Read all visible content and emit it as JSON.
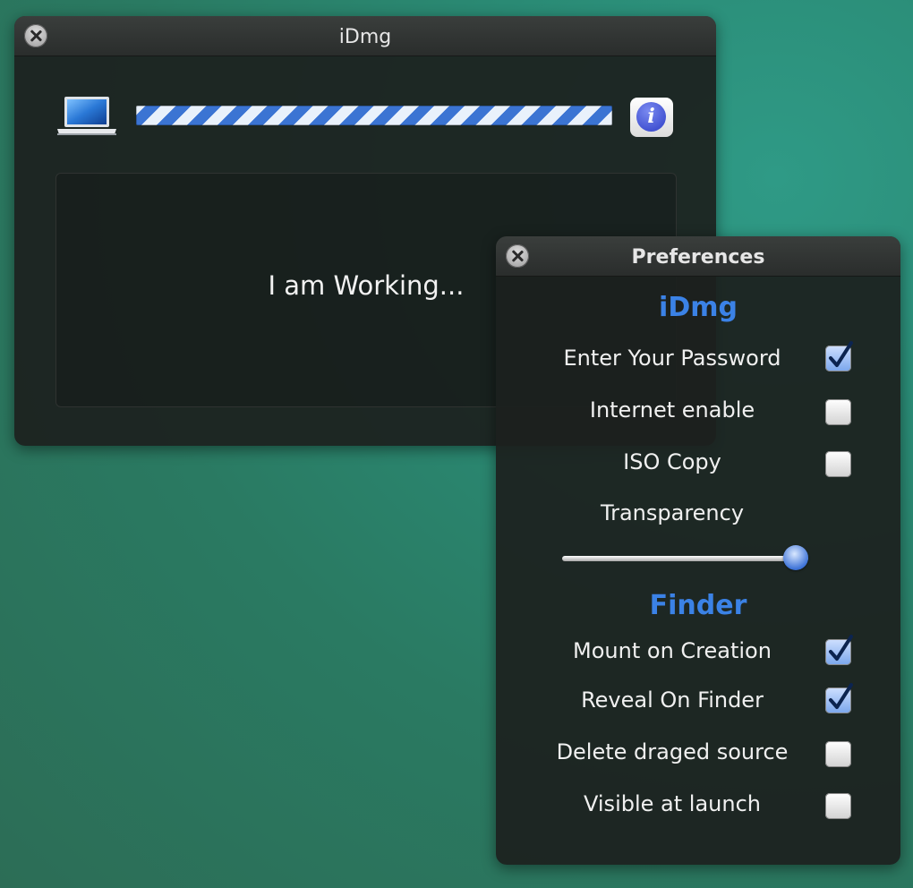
{
  "main_window": {
    "title": "iDmg",
    "status_text": "I am Working...",
    "progress_style": "indeterminate",
    "info_button_glyph": "i",
    "icons": {
      "close": "close-icon",
      "laptop": "laptop-icon",
      "info": "info-icon"
    }
  },
  "preferences": {
    "title": "Preferences",
    "sections": [
      {
        "heading": "iDmg",
        "items": [
          {
            "label": "Enter Your Password",
            "checked": true
          },
          {
            "label": "Internet enable",
            "checked": false
          },
          {
            "label": "ISO Copy",
            "checked": false
          }
        ],
        "slider": {
          "label": "Transparency",
          "value": 0.95
        }
      },
      {
        "heading": "Finder",
        "items": [
          {
            "label": "Mount on Creation",
            "checked": true
          },
          {
            "label": "Reveal On Finder",
            "checked": true
          },
          {
            "label": "Delete draged source",
            "checked": false
          },
          {
            "label": "Visible at launch",
            "checked": false
          }
        ]
      }
    ]
  },
  "colors": {
    "desktop": "#2a7a62",
    "accent_heading": "#3b82e6",
    "progress_blue": "#3b74d3",
    "hud_background": "#1c201e"
  }
}
